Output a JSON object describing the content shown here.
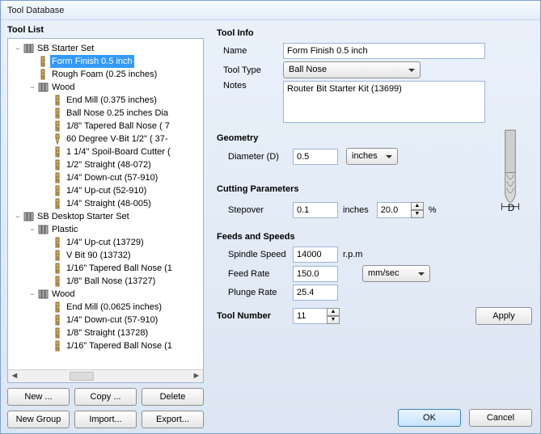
{
  "window_title": "Tool Database",
  "tool_list_label": "Tool List",
  "tree": [
    {
      "depth": 0,
      "toggle": "−",
      "icon": "toolset",
      "label": "SB Starter Set",
      "sel": false,
      "name": "tree-sb-starter-set"
    },
    {
      "depth": 1,
      "toggle": "",
      "icon": "bit",
      "label": "Form Finish 0.5 inch",
      "sel": true,
      "name": "tree-form-finish"
    },
    {
      "depth": 1,
      "toggle": "",
      "icon": "bit",
      "label": "Rough Foam (0.25 inches)",
      "sel": false,
      "name": "tree-rough-foam"
    },
    {
      "depth": 1,
      "toggle": "−",
      "icon": "toolset",
      "label": "Wood",
      "sel": false,
      "name": "tree-wood-1"
    },
    {
      "depth": 2,
      "toggle": "",
      "icon": "bit",
      "label": "End Mill (0.375 inches)",
      "sel": false,
      "name": "tree-end-mill-375"
    },
    {
      "depth": 2,
      "toggle": "",
      "icon": "bit",
      "label": "Ball Nose 0.25 inches Dia",
      "sel": false,
      "name": "tree-ball-nose-025"
    },
    {
      "depth": 2,
      "toggle": "",
      "icon": "bit",
      "label": "1/8\" Tapered Ball Nose  ( 7",
      "sel": false,
      "name": "tree-tapered-18"
    },
    {
      "depth": 2,
      "toggle": "",
      "icon": "vbit",
      "label": "60 Degree V-Bit 1/2\"  ( 37-",
      "sel": false,
      "name": "tree-60-vbit"
    },
    {
      "depth": 2,
      "toggle": "",
      "icon": "bit",
      "label": "1 1/4\" Spoil-Board Cutter (",
      "sel": false,
      "name": "tree-spoilboard"
    },
    {
      "depth": 2,
      "toggle": "",
      "icon": "bit",
      "label": "1/2\" Straight  (48-072)",
      "sel": false,
      "name": "tree-12-straight"
    },
    {
      "depth": 2,
      "toggle": "",
      "icon": "bit",
      "label": "1/4\" Down-cut (57-910)",
      "sel": false,
      "name": "tree-14-downcut"
    },
    {
      "depth": 2,
      "toggle": "",
      "icon": "bit",
      "label": "1/4\" Up-cut (52-910)",
      "sel": false,
      "name": "tree-14-upcut"
    },
    {
      "depth": 2,
      "toggle": "",
      "icon": "bit",
      "label": "1/4\" Straight  (48-005)",
      "sel": false,
      "name": "tree-14-straight"
    },
    {
      "depth": 0,
      "toggle": "−",
      "icon": "toolset",
      "label": "SB Desktop Starter Set",
      "sel": false,
      "name": "tree-sb-desktop"
    },
    {
      "depth": 1,
      "toggle": "−",
      "icon": "toolset",
      "label": "Plastic",
      "sel": false,
      "name": "tree-plastic"
    },
    {
      "depth": 2,
      "toggle": "",
      "icon": "bit",
      "label": "1/4\" Up-cut (13729)",
      "sel": false,
      "name": "tree-upcut-13729"
    },
    {
      "depth": 2,
      "toggle": "",
      "icon": "bit",
      "label": "V Bit 90 (13732)",
      "sel": false,
      "name": "tree-vbit90"
    },
    {
      "depth": 2,
      "toggle": "",
      "icon": "bit",
      "label": "1/16\" Tapered Ball Nose (1",
      "sel": false,
      "name": "tree-tapered-116a"
    },
    {
      "depth": 2,
      "toggle": "",
      "icon": "bit",
      "label": "1/8\" Ball Nose (13727)",
      "sel": false,
      "name": "tree-ball-nose-13727"
    },
    {
      "depth": 1,
      "toggle": "−",
      "icon": "toolset",
      "label": "Wood",
      "sel": false,
      "name": "tree-wood-2"
    },
    {
      "depth": 2,
      "toggle": "",
      "icon": "bit",
      "label": "End Mill (0.0625 inches)",
      "sel": false,
      "name": "tree-end-mill-0625"
    },
    {
      "depth": 2,
      "toggle": "",
      "icon": "bit",
      "label": "1/4\" Down-cut (57-910)",
      "sel": false,
      "name": "tree-14-downcut-b"
    },
    {
      "depth": 2,
      "toggle": "",
      "icon": "bit",
      "label": "1/8\" Straight (13728)",
      "sel": false,
      "name": "tree-18-straight"
    },
    {
      "depth": 2,
      "toggle": "",
      "icon": "bit",
      "label": "1/16\" Tapered Ball Nose (1",
      "sel": false,
      "name": "tree-tapered-116b"
    }
  ],
  "buttons": {
    "new": "New ...",
    "copy": "Copy ...",
    "delete": "Delete",
    "new_group": "New Group",
    "import": "Import...",
    "export": "Export..."
  },
  "info": {
    "title": "Tool Info",
    "name_label": "Name",
    "name_value": "Form Finish 0.5 inch",
    "type_label": "Tool Type",
    "type_value": "Ball Nose",
    "notes_label": "Notes",
    "notes_value": "Router Bit Starter Kit (13699)"
  },
  "geometry": {
    "title": "Geometry",
    "diameter_label": "Diameter (D)",
    "diameter_value": "0.5",
    "diameter_units": "inches"
  },
  "cutting": {
    "title": "Cutting Parameters",
    "stepover_label": "Stepover",
    "stepover_value": "0.1",
    "stepover_units": "inches",
    "stepover_pct": "20.0",
    "pct_sign": "%"
  },
  "feeds": {
    "title": "Feeds and Speeds",
    "spindle_label": "Spindle Speed",
    "spindle_value": "14000",
    "spindle_units": "r.p.m",
    "feed_label": "Feed Rate",
    "feed_value": "150.0",
    "plunge_label": "Plunge Rate",
    "plunge_value": "25.4",
    "rate_units": "mm/sec"
  },
  "tool_number": {
    "label": "Tool Number",
    "value": "11"
  },
  "actions": {
    "apply": "Apply",
    "ok": "OK",
    "cancel": "Cancel"
  }
}
